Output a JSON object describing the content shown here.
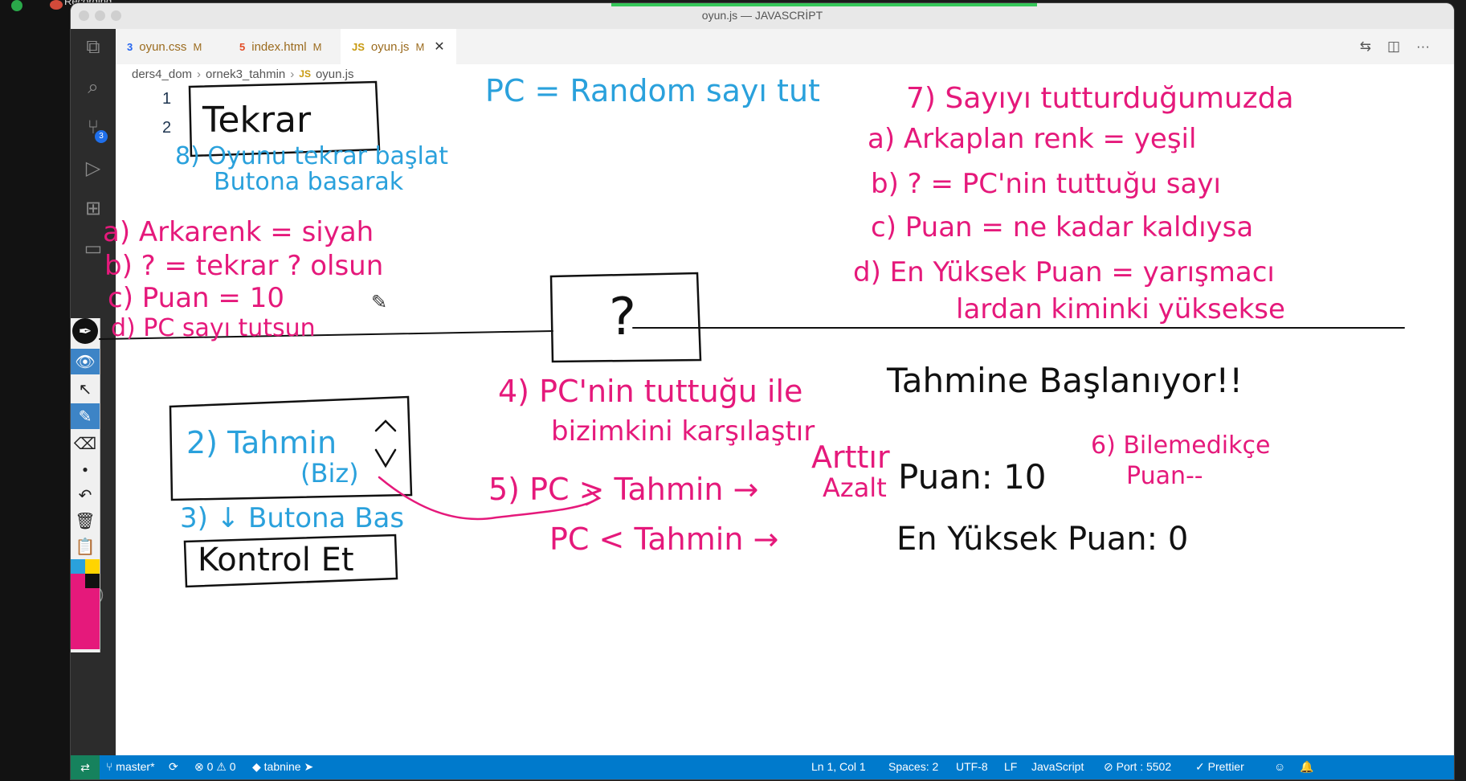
{
  "recording": {
    "label": "Recording"
  },
  "window": {
    "title": "oyun.js — JAVASCRİPT"
  },
  "tabs": [
    {
      "icon": "css3-icon",
      "name": "oyun.css",
      "status": "M"
    },
    {
      "icon": "html5-icon",
      "name": "index.html",
      "status": "M"
    },
    {
      "icon": "js-file-icon",
      "name": "oyun.js",
      "status": "M",
      "active": true
    }
  ],
  "breadcrumb": {
    "folder1": "ders4_dom",
    "folder2": "ornek3_tahmin",
    "file": "oyun.js",
    "file_icon": "JS"
  },
  "editor": {
    "line_numbers": [
      "1",
      "2"
    ]
  },
  "activity": {
    "scm_badge": "3"
  },
  "ink": {
    "tekrar_box": "Tekrar",
    "pc_random": "PC = Random sayı tut",
    "step8_1": "8) Oyunu tekrar başlat",
    "step8_2": "Butona basarak",
    "left_a": "a) Arkarenk = siyah",
    "left_b": "b) ? = tekrar ? olsun",
    "left_c": "c) Puan = 10",
    "left_d": "d) PC sayı tutsun",
    "question_box": "?",
    "step7": "7) Sayıyı tutturduğumuzda",
    "right_a": "a) Arkaplan renk = yeşil",
    "right_b": "b) ? = PC'nin tuttuğu sayı",
    "right_c": "c) Puan = ne kadar kaldıysa",
    "right_d1": "d) En Yüksek Puan = yarışmacı",
    "right_d2": "lardan kiminki yüksekse",
    "step4_1": "4) PC'nin tuttuğu ile",
    "step4_2": "bizimkini karşılaştır",
    "guess_box_1": "2) Tahmin",
    "guess_box_2": "(Biz)",
    "step3": "3) ↓ Butona Bas",
    "check_box": "Kontrol Et",
    "step5_1": "5) PC > Tahmin →",
    "step5_2": "PC < Tahmin →",
    "arttir": "Arttır",
    "azalt": "Azalt",
    "starting": "Tahmine Başlanıyor!!",
    "puan": "Puan: 10",
    "step6_1": "6) Bilemedikçe",
    "step6_2": "Puan--",
    "highscore": "En Yüksek Puan: 0"
  },
  "statusbar": {
    "branch": "master*",
    "errors": "0",
    "warnings": "0",
    "tabnine": "tabnine",
    "position": "Ln 1, Col 1",
    "spaces": "Spaces: 2",
    "encoding": "UTF-8",
    "eol": "LF",
    "language": "JavaScript",
    "port": "Port : 5502",
    "prettier": "Prettier"
  },
  "colors": {
    "accent_blue": "#2aa1dc",
    "ink_magenta": "#e5197b",
    "ink_black": "#111111",
    "status": "#007acc"
  }
}
